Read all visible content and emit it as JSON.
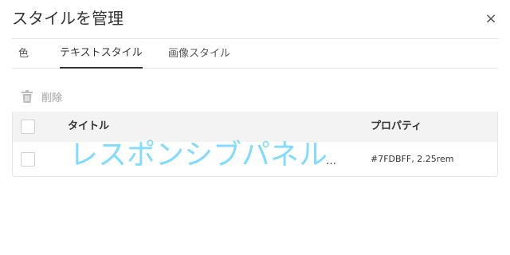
{
  "dialog": {
    "title": "スタイルを管理",
    "close_icon": "close-icon"
  },
  "tabs": [
    {
      "label": "色",
      "active": false
    },
    {
      "label": "テキストスタイル",
      "active": true
    },
    {
      "label": "画像スタイル",
      "active": false
    }
  ],
  "toolbar": {
    "delete_label": "削除",
    "delete_icon": "trash-icon"
  },
  "table": {
    "columns": {
      "title": "タイトル",
      "properties": "プロパティ"
    },
    "rows": [
      {
        "title": "レスポンシブパネル",
        "ellipsis": "…",
        "properties": "#7FDBFF, 2.25rem",
        "color": "#7FDBFF"
      }
    ]
  }
}
